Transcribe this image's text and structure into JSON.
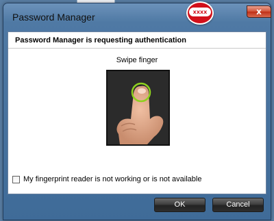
{
  "window": {
    "title": "Password Manager",
    "close_label": "x",
    "badge_label": "xxxx"
  },
  "content": {
    "heading": "Password Manager is requesting authentication",
    "prompt": "Swipe finger",
    "fallback_checkbox": {
      "label": "My fingerprint reader is not working or is not available",
      "checked": false
    }
  },
  "buttons": {
    "ok_label": "OK",
    "cancel_label": "Cancel"
  }
}
